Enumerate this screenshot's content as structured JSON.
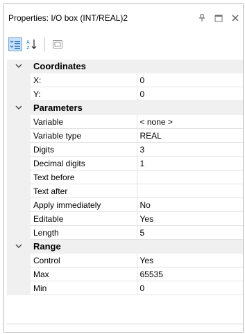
{
  "title": "Properties: I/O box (INT/REAL)2",
  "title_icons": [
    "pin-icon",
    "maximize-icon",
    "close-icon"
  ],
  "toolbar": {
    "categorized_icon": "categorized-icon",
    "alphabetical_icon": "alphabetical-sort-icon",
    "pages_icon": "property-pages-icon"
  },
  "categories": [
    {
      "name": "Coordinates",
      "expanded": true,
      "properties": [
        {
          "name": "X:",
          "value": "0"
        },
        {
          "name": "Y:",
          "value": "0"
        }
      ]
    },
    {
      "name": "Parameters",
      "expanded": true,
      "properties": [
        {
          "name": "Variable",
          "value": "< none >"
        },
        {
          "name": "Variable type",
          "value": "REAL"
        },
        {
          "name": "Digits",
          "value": "3"
        },
        {
          "name": "Decimal digits",
          "value": "1"
        },
        {
          "name": "Text before",
          "value": ""
        },
        {
          "name": "Text after",
          "value": ""
        },
        {
          "name": "Apply immediately",
          "value": "No"
        },
        {
          "name": "Editable",
          "value": "Yes"
        },
        {
          "name": "Length",
          "value": "5"
        }
      ]
    },
    {
      "name": "Range",
      "expanded": true,
      "properties": [
        {
          "name": "Control",
          "value": "Yes"
        },
        {
          "name": "Max",
          "value": "65535"
        },
        {
          "name": "Min",
          "value": "0"
        }
      ]
    }
  ],
  "colors": {
    "gutter": "#f0f0f0",
    "toolbar_active": "#c9e0f7",
    "toolbar_active_border": "#6fa8dc",
    "icon_blue": "#1e73be"
  }
}
